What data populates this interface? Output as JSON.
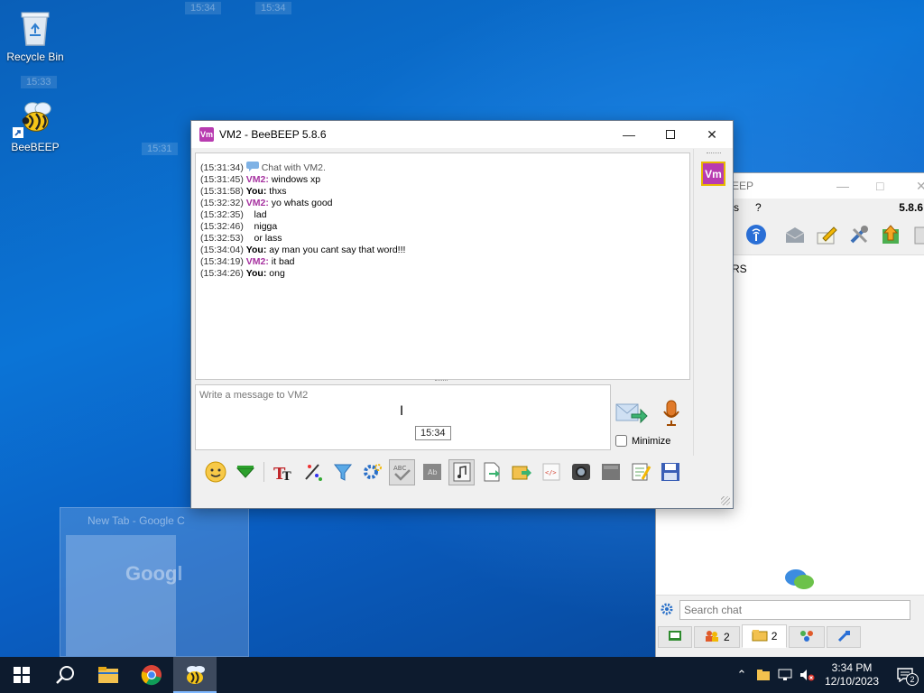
{
  "desktop": {
    "icons": [
      {
        "label": "Recycle Bin"
      },
      {
        "label": "BeeBEEP"
      }
    ],
    "ghost_times": [
      "15:34",
      "15:34",
      "15:33",
      "15:31"
    ],
    "ghost_window_title": "New Tab - Google C",
    "ghost_window_logo": "Googl"
  },
  "chat_window": {
    "title": "VM2 - BeeBEEP 5.8.6",
    "app_icon_text": "Vm",
    "avatar_text": "Vm",
    "messages": [
      {
        "time": "(15:31:34)",
        "user": "",
        "text": "Chat with VM2.",
        "kind": "system"
      },
      {
        "time": "(15:31:45)",
        "user": "VM2:",
        "text": " windows xp",
        "kind": "vm2"
      },
      {
        "time": "(15:31:58)",
        "user": "You:",
        "text": " thxs",
        "kind": "you"
      },
      {
        "time": "(15:32:32)",
        "user": "VM2:",
        "text": " yo whats good",
        "kind": "vm2"
      },
      {
        "time": "(15:32:35)",
        "user": "",
        "text": "    lad",
        "kind": "cont"
      },
      {
        "time": "(15:32:46)",
        "user": "",
        "text": "    nigga",
        "kind": "cont"
      },
      {
        "time": "(15:32:53)",
        "user": "",
        "text": "    or lass",
        "kind": "cont"
      },
      {
        "time": "(15:34:04)",
        "user": "You:",
        "text": " ay man you cant say that word!!!",
        "kind": "you"
      },
      {
        "time": "(15:34:19)",
        "user": "VM2:",
        "text": " it bad",
        "kind": "vm2"
      },
      {
        "time": "(15:34:26)",
        "user": "You:",
        "text": " ong",
        "kind": "you"
      }
    ],
    "compose_placeholder": "Write a message to VM2",
    "tooltip": "15:34",
    "minimize_label": "Minimize"
  },
  "main_window": {
    "title_fragment": "EEP",
    "version": "5.8.6",
    "menu": [
      "s",
      "?"
    ],
    "list_fragment": "RS",
    "search_placeholder": "Search chat",
    "tabs": [
      {
        "count": "2",
        "active": false
      },
      {
        "count": "2",
        "active": true
      }
    ]
  },
  "taskbar": {
    "time": "3:34 PM",
    "date": "12/10/2023",
    "notification_count": "2"
  },
  "colors": {
    "vm2_name": "#a632a0",
    "avatar_bg": "#b83bb0",
    "taskbar_bg": "#0d1b2e"
  }
}
